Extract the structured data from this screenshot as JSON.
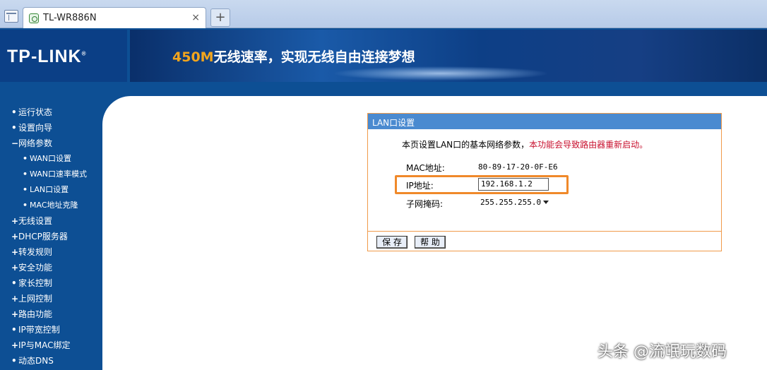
{
  "browser": {
    "tab_title": "TL-WR886N",
    "close_glyph": "×",
    "new_tab_glyph": "+"
  },
  "header": {
    "logo": "TP-LINK",
    "logo_mark": "®",
    "slogan_highlight": "450M",
    "slogan_rest": "无线速率，实现无线自由连接梦想"
  },
  "menu": {
    "items": [
      {
        "label": "运行状态",
        "bullet": "•"
      },
      {
        "label": "设置向导",
        "bullet": "•"
      },
      {
        "label": "网络参数",
        "bullet": "−"
      },
      {
        "label": "WAN口设置",
        "bullet": "•",
        "sub": true
      },
      {
        "label": "WAN口速率模式",
        "bullet": "•",
        "sub": true
      },
      {
        "label": "LAN口设置",
        "bullet": "•",
        "sub": true
      },
      {
        "label": "MAC地址克隆",
        "bullet": "•",
        "sub": true
      },
      {
        "label": "无线设置",
        "bullet": "+"
      },
      {
        "label": "DHCP服务器",
        "bullet": "+"
      },
      {
        "label": "转发规则",
        "bullet": "+"
      },
      {
        "label": "安全功能",
        "bullet": "+"
      },
      {
        "label": "家长控制",
        "bullet": "•"
      },
      {
        "label": "上网控制",
        "bullet": "+"
      },
      {
        "label": "路由功能",
        "bullet": "+"
      },
      {
        "label": "IP带宽控制",
        "bullet": "•"
      },
      {
        "label": "IP与MAC绑定",
        "bullet": "+"
      },
      {
        "label": "动态DNS",
        "bullet": "•"
      }
    ]
  },
  "panel": {
    "title": "LAN口设置",
    "desc_normal": "本页设置LAN口的基本网络参数，",
    "desc_warn": "本功能会导致路由器重新启动。",
    "mac_label": "MAC地址:",
    "mac_value": "80-89-17-20-0F-E6",
    "ip_label": "IP地址:",
    "ip_value": "192.168.1.2",
    "mask_label": "子网掩码:",
    "mask_value": "255.255.255.0",
    "save_label": "保 存",
    "help_label": "帮 助"
  },
  "watermark": "头条 @流氓玩数码",
  "colors": {
    "brand_blue": "#0d4f94",
    "panel_title": "#4a8ad0",
    "highlight_orange": "#f0892a",
    "warning_red": "#c8102e"
  }
}
